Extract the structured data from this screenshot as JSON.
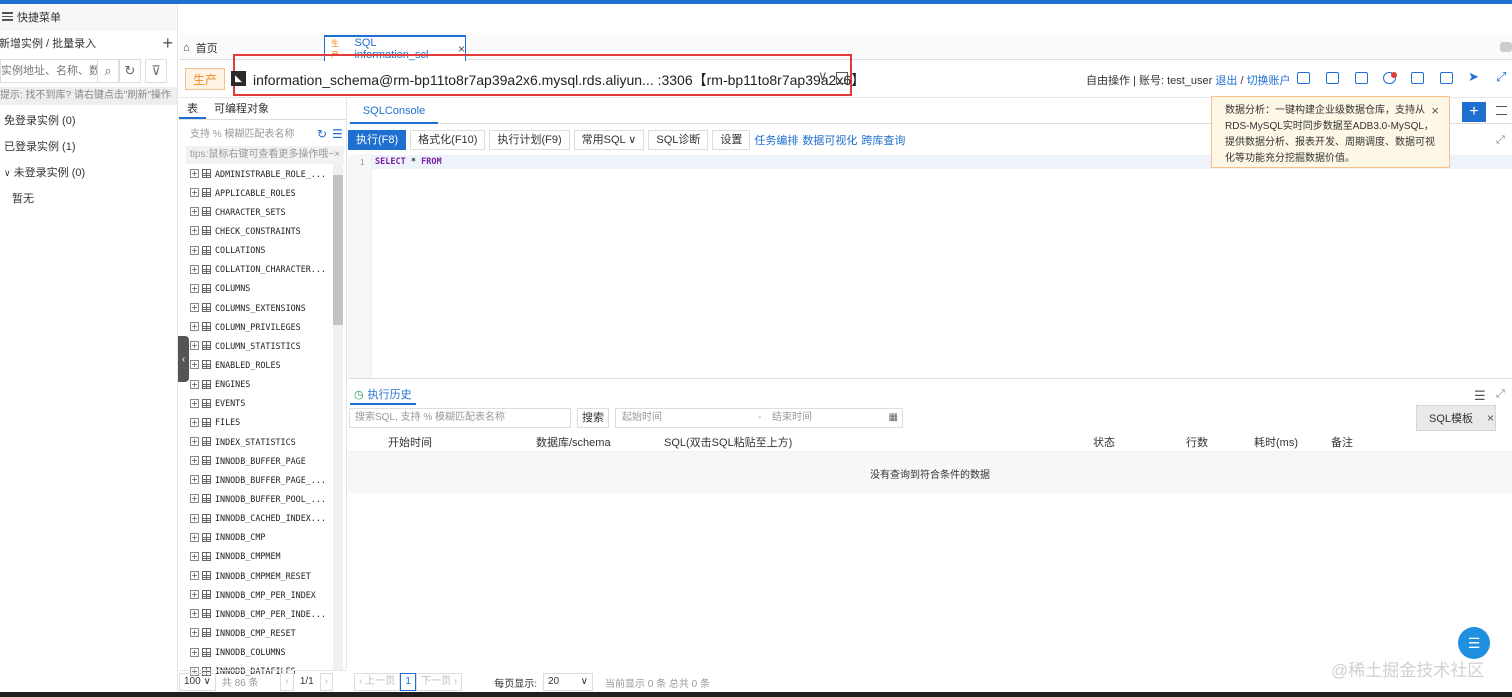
{
  "sidebar": {
    "menu_label": "快捷菜单",
    "add_label": "新增实例 / 批量录入",
    "search_placeholder": "实例地址、名称、数据",
    "hint": "提示: 找不到库? 请右键点击\"刷新\"操作",
    "groups": [
      {
        "label": "免登录实例 (0)"
      },
      {
        "label": "已登录实例 (1)"
      },
      {
        "label": "未登录实例 (0)"
      }
    ],
    "empty_label": "暂无"
  },
  "tabs": {
    "home": "首页",
    "sql_tab_env": "生产",
    "sql_tab_title": "SQL information_scl"
  },
  "instance": {
    "env": "生产",
    "connection": "information_schema@rm-bp11to8r7ap39a2x6.mysql.rds.aliyun... :3306【rm-bp11to8r7ap39a2x6】",
    "mode_text": "自由操作 | 账号: test_user",
    "logout": "退出",
    "switch_account": "切换账户"
  },
  "objects": {
    "tab_table": "表",
    "tab_programmable": "可编程对象",
    "search_placeholder": "支持 % 模糊匹配表名称",
    "tips": "tips:鼠标右键可查看更多操作哦~",
    "tables": [
      "ADMINISTRABLE_ROLE_...",
      "APPLICABLE_ROLES",
      "CHARACTER_SETS",
      "CHECK_CONSTRAINTS",
      "COLLATIONS",
      "COLLATION_CHARACTER...",
      "COLUMNS",
      "COLUMNS_EXTENSIONS",
      "COLUMN_PRIVILEGES",
      "COLUMN_STATISTICS",
      "ENABLED_ROLES",
      "ENGINES",
      "EVENTS",
      "FILES",
      "INDEX_STATISTICS",
      "INNODB_BUFFER_PAGE",
      "INNODB_BUFFER_PAGE_...",
      "INNODB_BUFFER_POOL_...",
      "INNODB_CACHED_INDEX...",
      "INNODB_CMP",
      "INNODB_CMPMEM",
      "INNODB_CMPMEM_RESET",
      "INNODB_CMP_PER_INDEX",
      "INNODB_CMP_PER_INDE...",
      "INNODB_CMP_RESET",
      "INNODB_COLUMNS",
      "INNODB_DATAFILES"
    ],
    "page_size": "100",
    "total": "共 86 条",
    "page": "1/1"
  },
  "editor": {
    "tab": "SQLConsole",
    "toolbar": {
      "run": "执行(F8)",
      "format": "格式化(F10)",
      "plan": "执行计划(F9)",
      "common_sql": "常用SQL",
      "diagnose": "SQL诊断",
      "settings": "设置",
      "task_orchestration": "任务编排",
      "visualization": "数据可视化",
      "cross_db_query": "跨库查询"
    },
    "line_number": "1",
    "code_select": "SELECT",
    "code_star": "*",
    "code_from": "FROM"
  },
  "notice": {
    "text": "数据分析：一键构建企业级数据仓库，支持从RDS-MySQL实时同步数据至ADB3.0-MySQL，提供数据分析、报表开发、周期调度、数据可视化等功能充分挖掘数据价值。"
  },
  "history": {
    "tab": "执行历史",
    "search_placeholder": "搜索SQL, 支持 % 模糊匹配表名称",
    "search_button": "搜索",
    "start_time": "起始时间",
    "end_time": "结束时间",
    "date_sep": "-",
    "columns": [
      "开始时间",
      "数据库/schema",
      "SQL(双击SQL粘贴至上方)",
      "状态",
      "行数",
      "耗时(ms)",
      "备注"
    ],
    "empty_text": "没有查询到符合条件的数据",
    "sql_template": "SQL模板"
  },
  "pager": {
    "prev": "上一页",
    "current": "1",
    "next": "下一页",
    "per_page_label": "每页显示:",
    "per_page_value": "20",
    "summary": "当前显示 0 条 总共 0 条"
  },
  "watermark": "@稀土掘金技术社区",
  "colors": {
    "accent": "#1f6fd1",
    "warning": "#f08a24",
    "highlight_box": "#e23b3b"
  }
}
